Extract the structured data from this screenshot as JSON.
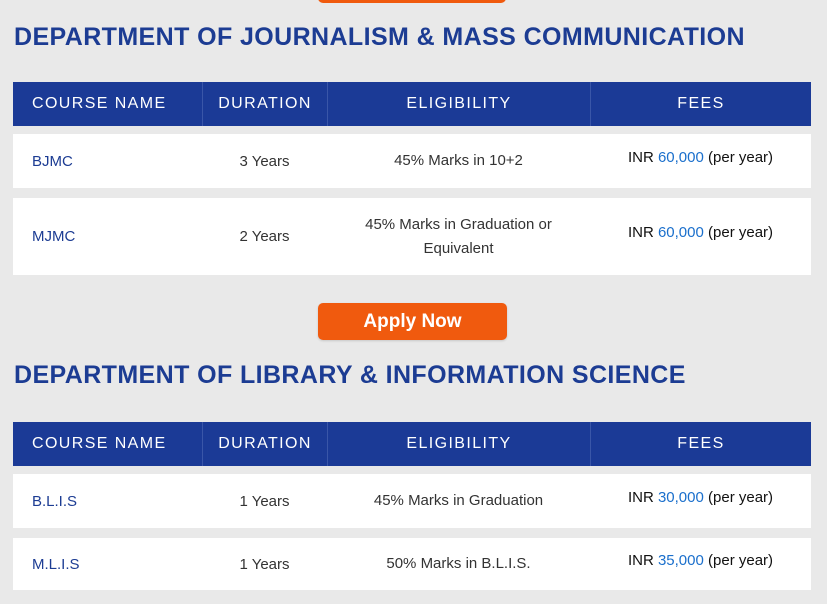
{
  "apply_button_label": "Apply Now",
  "departments": [
    {
      "title": "DEPARTMENT OF JOURNALISM & MASS COMMUNICATION",
      "headers": [
        "COURSE NAME",
        "DURATION",
        "ELIGIBILITY",
        "FEES"
      ],
      "rows": [
        {
          "course": "BJMC",
          "duration": "3 Years",
          "eligibility": "45% Marks in 10+2",
          "fee_currency": "INR",
          "fee_amount": "60,000",
          "fee_period": "(per year)"
        },
        {
          "course": "MJMC",
          "duration": "2 Years",
          "eligibility": "45% Marks in Graduation or Equivalent",
          "fee_currency": "INR",
          "fee_amount": "60,000",
          "fee_period": "(per year)"
        }
      ]
    },
    {
      "title": "DEPARTMENT OF LIBRARY & INFORMATION SCIENCE",
      "headers": [
        "COURSE NAME",
        "DURATION",
        "ELIGIBILITY",
        "FEES"
      ],
      "rows": [
        {
          "course": "B.L.I.S",
          "duration": "1 Years",
          "eligibility": "45% Marks in Graduation",
          "fee_currency": "INR",
          "fee_amount": "30,000",
          "fee_period": "(per year)"
        },
        {
          "course": "M.L.I.S",
          "duration": "1 Years",
          "eligibility": "50% Marks in B.L.I.S.",
          "fee_currency": "INR",
          "fee_amount": "35,000",
          "fee_period": "(per year)"
        }
      ]
    }
  ],
  "colors": {
    "accent_orange": "#f05a0e",
    "header_blue": "#1b3a96",
    "title_blue": "#1c3c93",
    "fee_blue": "#1a6fcc"
  }
}
